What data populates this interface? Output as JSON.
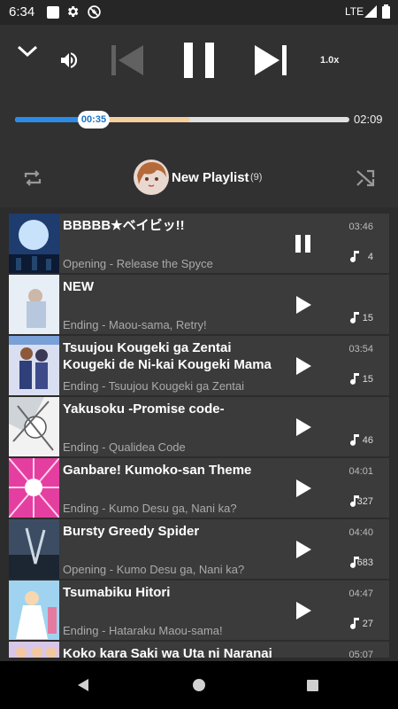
{
  "status_bar": {
    "time": "6:34",
    "network": "LTE"
  },
  "player": {
    "speed": "1.0x",
    "current_time": "00:35",
    "total_time": "02:09",
    "progress": 0.27,
    "buffered": 0.48
  },
  "playlist": {
    "name": "New Playlist",
    "count": "(9)"
  },
  "tracks": [
    {
      "title": "BBBBB★ベイビッ!!",
      "subtitle": "Opening - Release the Spyce",
      "duration": "03:46",
      "plays": "4",
      "state": "pause"
    },
    {
      "title": "NEW",
      "subtitle": "Ending - Maou-sama, Retry!",
      "duration": "",
      "plays": "15",
      "state": "play"
    },
    {
      "title": "Tsuujou Kougeki ga Zentai Kougeki de Ni-kai Kougeki Mama",
      "subtitle": "Ending - Tsuujou Kougeki ga Zentai",
      "duration": "03:54",
      "plays": "15",
      "state": "play"
    },
    {
      "title": "Yakusoku -Promise code-",
      "subtitle": "Ending - Qualidea Code",
      "duration": "",
      "plays": "46",
      "state": "play"
    },
    {
      "title": "Ganbare! Kumoko-san Theme",
      "subtitle": "Ending - Kumo Desu ga, Nani ka?",
      "duration": "04:01",
      "plays": "327",
      "state": "play"
    },
    {
      "title": "Bursty Greedy Spider",
      "subtitle": "Opening - Kumo Desu ga, Nani ka?",
      "duration": "04:40",
      "plays": "683",
      "state": "play"
    },
    {
      "title": "Tsumabiku Hitori",
      "subtitle": "Ending - Hataraku Maou-sama!",
      "duration": "04:47",
      "plays": "27",
      "state": "play"
    },
    {
      "title": "Koko kara Saki wa Uta ni Naranai",
      "subtitle": "",
      "duration": "05:07",
      "plays": "",
      "state": "play"
    }
  ]
}
